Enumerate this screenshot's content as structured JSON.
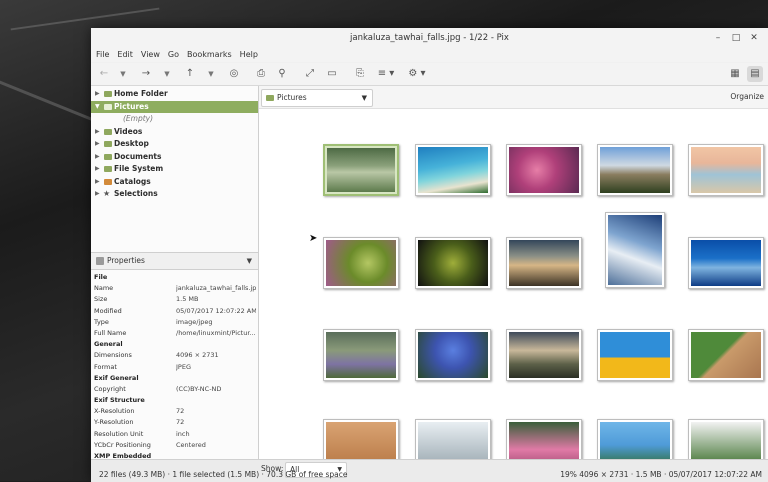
{
  "window": {
    "title": "jankaluza_tawhai_falls.jpg - 1/22 - Pix"
  },
  "menu": [
    "File",
    "Edit",
    "View",
    "Go",
    "Bookmarks",
    "Help"
  ],
  "tree": {
    "items": [
      {
        "label": "Home Folder",
        "arrow": "▶"
      },
      {
        "label": "Pictures",
        "arrow": "▼"
      },
      {
        "label": "(Empty)",
        "arrow": ""
      },
      {
        "label": "Videos",
        "arrow": "▶"
      },
      {
        "label": "Desktop",
        "arrow": "▶"
      },
      {
        "label": "Documents",
        "arrow": "▶"
      },
      {
        "label": "File System",
        "arrow": "▶"
      },
      {
        "label": "Catalogs",
        "arrow": "▶"
      },
      {
        "label": "Selections",
        "arrow": "▶"
      }
    ]
  },
  "properties": {
    "header": "Properties",
    "rows": [
      {
        "k": "File",
        "v": ""
      },
      {
        "k": "Name",
        "v": "jankaluza_tawhai_falls.jpg"
      },
      {
        "k": "Size",
        "v": "1.5 MB"
      },
      {
        "k": "Modified",
        "v": "05/07/2017 12:07:22 AM"
      },
      {
        "k": "Type",
        "v": "image/jpeg"
      },
      {
        "k": "Full Name",
        "v": "/home/linuxmint/Pictur..."
      },
      {
        "k": "General",
        "v": ""
      },
      {
        "k": "Dimensions",
        "v": "4096 × 2731"
      },
      {
        "k": "Format",
        "v": "JPEG"
      },
      {
        "k": "Exif General",
        "v": ""
      },
      {
        "k": "Copyright",
        "v": "(CC)BY-NC-ND"
      },
      {
        "k": "Exif Structure",
        "v": ""
      },
      {
        "k": "X-Resolution",
        "v": "72"
      },
      {
        "k": "Y-Resolution",
        "v": "72"
      },
      {
        "k": "Resolution Unit",
        "v": "inch"
      },
      {
        "k": "YCbCr Positioning",
        "v": "Centered"
      },
      {
        "k": "XMP Embedded",
        "v": ""
      }
    ]
  },
  "location": {
    "label": "Pictures",
    "organize": "Organize"
  },
  "thumbnails": [
    {
      "selected": true,
      "g": "linear-gradient(180deg,#4e6b45 0%,#8aa07a 40%,#b9c7a6 55%,#5d7a4c 100%)"
    },
    {
      "selected": false,
      "g": "linear-gradient(170deg,#1f7fc0 0%,#46b2d9 40%,#7fd4dc 60%,#e8e3cf 80%,#2e6b2f 100%)"
    },
    {
      "selected": false,
      "g": "radial-gradient(circle at 40% 50%,#e67ea7 0%,#b0407a 40%,#5b2a52 100%)"
    },
    {
      "selected": false,
      "g": "linear-gradient(180deg,#6fa0d8 0%,#cfd9e2 40%,#8a7d5f 60%,#2f4020 100%)"
    },
    {
      "selected": false,
      "g": "linear-gradient(180deg,#f1c6a5 0%,#e8b69a 35%,#9fc3d6 60%,#d9c7a8 100%)"
    },
    {
      "selected": false,
      "g": "radial-gradient(circle at 60% 50%,#b4c763 0%,#6b8b2a 40%,#a05a8a 100%)"
    },
    {
      "selected": false,
      "g": "radial-gradient(circle at 50% 50%,#9fae3a 0%,#4a5e1a 45%,#111 100%)"
    },
    {
      "selected": false,
      "g": "linear-gradient(180deg,#33465a 0%,#8a8f86 35%,#d6b686 55%,#3c3225 100%)"
    },
    {
      "selected": false,
      "g": "linear-gradient(200deg,#1e3f78 0%,#7ea4cf 40%,#e8eef4 60%,#4d6f99 100%)"
    },
    {
      "selected": false,
      "g": "linear-gradient(180deg,#0a4ea8 0%,#1b70c8 40%,#7fb4e0 60%,#0e3c86 100%)"
    },
    {
      "selected": false,
      "g": "linear-gradient(180deg,#5a6e5a 0%,#8a9a7a 40%,#7e73a3 70%,#4f6a3a 100%)"
    },
    {
      "selected": false,
      "g": "radial-gradient(circle at 50% 40%,#5a7fe0 0%,#3d54b0 40%,#2a4a2a 100%)"
    },
    {
      "selected": false,
      "g": "linear-gradient(180deg,#3e4a5a 0%,#c9b89a 40%,#5c6048 70%,#2b2f24 100%)"
    },
    {
      "selected": false,
      "g": "linear-gradient(180deg,#2f8ed8 0%,#2f8ed8 55%,#f2b81a 55%,#f2b81a 100%)"
    },
    {
      "selected": false,
      "g": "linear-gradient(135deg,#4f8a3a 0%,#4f8a3a 45%,#c99a6a 50%,#a97650 100%)"
    },
    {
      "selected": false,
      "g": "linear-gradient(180deg,#d9a373 0%,#b77845 100%)"
    },
    {
      "selected": false,
      "g": "linear-gradient(180deg,#e8eef2 0%,#9aa8b0 100%)"
    },
    {
      "selected": false,
      "g": "linear-gradient(180deg,#3a5e3a 0%,#e07aa6 60%,#a24c74 100%)"
    },
    {
      "selected": false,
      "g": "linear-gradient(180deg,#6fb6e8 0%,#4f9bd8 50%,#2e6a2e 100%)"
    },
    {
      "selected": false,
      "g": "linear-gradient(180deg,#f2f2f2 0%,#3a6e2a 100%)"
    }
  ],
  "status": {
    "show_label": "Show:",
    "show_value": "All",
    "left": "22 files (49.3 MB) · 1 file selected (1.5 MB) · 70.3 GB of free space",
    "right": "19% 4096 × 2731 · 1.5 MB · 05/07/2017 12:07:22 AM"
  }
}
